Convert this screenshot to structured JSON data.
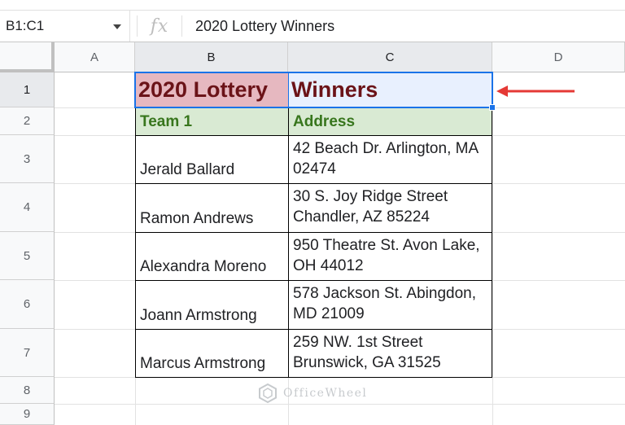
{
  "formula_bar": {
    "name_box": "B1:C1",
    "fx_label": "fx",
    "formula": "2020 Lottery Winners"
  },
  "columns": [
    "A",
    "B",
    "C",
    "D"
  ],
  "rows": [
    "1",
    "2",
    "3",
    "4",
    "5",
    "6",
    "7",
    "8",
    "9"
  ],
  "sheet": {
    "title_b": "2020 Lottery",
    "title_c": "Winners",
    "header_team": "Team 1",
    "header_address": "Address",
    "entries": [
      {
        "name": "Jerald Ballard",
        "address": "42 Beach Dr. Arlington, MA 02474"
      },
      {
        "name": "Ramon Andrews",
        "address": "30 S. Joy Ridge Street Chandler, AZ 85224"
      },
      {
        "name": "Alexandra Moreno",
        "address": "950 Theatre St. Avon Lake, OH 44012"
      },
      {
        "name": "Joann Armstrong",
        "address": "578 Jackson St. Abingdon, MD 21009"
      },
      {
        "name": "Marcus Armstrong",
        "address": "259 NW. 1st Street Brunswick, GA 31525"
      }
    ]
  },
  "colors": {
    "selection": "#1a73e8",
    "title_fill": "#e6b8c0",
    "title_text": "#6b1318",
    "header_fill": "#d9ead3",
    "header_text": "#38761d",
    "arrow": "#e53935"
  },
  "icons": {
    "name_box_dropdown": "chevron-down-icon",
    "watermark_logo": "officewheel-logo-icon",
    "annotation": "red-arrow-icon"
  },
  "watermark": "OfficeWheel"
}
